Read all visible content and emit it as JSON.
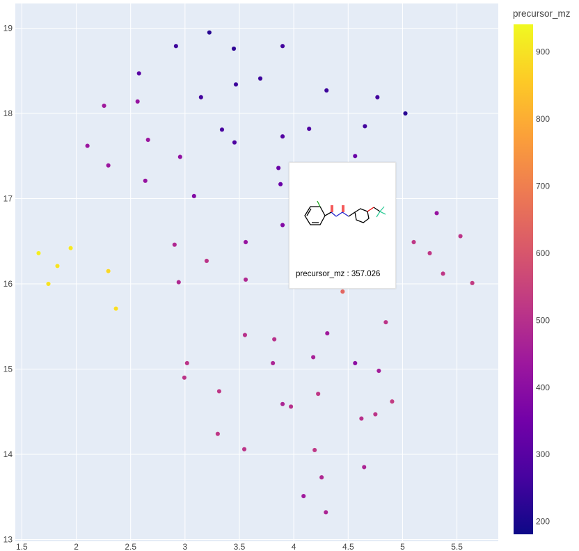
{
  "chart_data": {
    "type": "scatter",
    "title": "",
    "xlabel": "",
    "ylabel": "",
    "xlim": [
      1.44,
      5.88
    ],
    "ylim": [
      12.98,
      19.29
    ],
    "grid": true,
    "x_ticks": [
      1.5,
      2,
      2.5,
      3,
      3.5,
      4,
      4.5,
      5,
      5.5
    ],
    "x_tick_labels": [
      "1.5",
      "2",
      "2.5",
      "3",
      "3.5",
      "4",
      "4.5",
      "5",
      "5.5"
    ],
    "y_ticks": [
      13,
      14,
      15,
      16,
      17,
      18,
      19
    ],
    "y_tick_labels": [
      "13",
      "14",
      "15",
      "16",
      "17",
      "18",
      "19"
    ],
    "colorbar": {
      "title": "precursor_mz",
      "colorscale": "Plasma",
      "colors": [
        "#0d0887",
        "#46039f",
        "#7201a8",
        "#9c179e",
        "#bd3786",
        "#d8576b",
        "#ed7953",
        "#fb9f3a",
        "#fdca26",
        "#f0f921"
      ],
      "cmin": 181,
      "cmax": 941,
      "ticks": [
        200,
        300,
        400,
        500,
        600,
        700,
        800,
        900
      ],
      "tick_labels": [
        "200",
        "300",
        "400",
        "500",
        "600",
        "700",
        "800",
        "900"
      ]
    },
    "points": [
      [
        3.224,
        18.95,
        220
      ],
      [
        2.917,
        18.79,
        250
      ],
      [
        3.449,
        18.76,
        230
      ],
      [
        3.897,
        18.79,
        260
      ],
      [
        2.577,
        18.47,
        300
      ],
      [
        3.692,
        18.41,
        250
      ],
      [
        3.468,
        18.34,
        250
      ],
      [
        3.147,
        18.19,
        260
      ],
      [
        4.301,
        18.27,
        250
      ],
      [
        4.769,
        18.19,
        260
      ],
      [
        2.256,
        18.09,
        440
      ],
      [
        2.564,
        18.14,
        420
      ],
      [
        5.026,
        18.0,
        220
      ],
      [
        3.34,
        17.81,
        270
      ],
      [
        4.141,
        17.82,
        280
      ],
      [
        4.654,
        17.85,
        260
      ],
      [
        3.897,
        17.73,
        290
      ],
      [
        3.455,
        17.66,
        280
      ],
      [
        2.103,
        17.62,
        430
      ],
      [
        2.66,
        17.69,
        430
      ],
      [
        2.955,
        17.49,
        410
      ],
      [
        4.564,
        17.5,
        330
      ],
      [
        2.295,
        17.39,
        430
      ],
      [
        3.859,
        17.36,
        330
      ],
      [
        2.635,
        17.21,
        420
      ],
      [
        3.878,
        17.17,
        330
      ],
      [
        3.083,
        17.03,
        380
      ],
      [
        5.314,
        16.83,
        420
      ],
      [
        3.897,
        16.69,
        380
      ],
      [
        5.103,
        16.49,
        520
      ],
      [
        3.558,
        16.49,
        420
      ],
      [
        2.904,
        16.46,
        480
      ],
      [
        5.532,
        16.56,
        510
      ],
      [
        5.25,
        16.36,
        520
      ],
      [
        1.654,
        16.36,
        920
      ],
      [
        1.949,
        16.42,
        910
      ],
      [
        1.827,
        16.21,
        900
      ],
      [
        3.199,
        16.27,
        510
      ],
      [
        2.295,
        16.15,
        880
      ],
      [
        5.372,
        16.12,
        520
      ],
      [
        1.744,
        16.0,
        900
      ],
      [
        2.942,
        16.02,
        480
      ],
      [
        3.558,
        16.05,
        480
      ],
      [
        4.186,
        16.0,
        540
      ],
      [
        5.641,
        16.01,
        530
      ],
      [
        2.365,
        15.71,
        890
      ],
      [
        4.449,
        15.91,
        640
      ],
      [
        4.846,
        15.55,
        510
      ],
      [
        4.308,
        15.42,
        440
      ],
      [
        3.551,
        15.4,
        500
      ],
      [
        3.821,
        15.35,
        500
      ],
      [
        3.019,
        15.07,
        510
      ],
      [
        3.808,
        15.07,
        470
      ],
      [
        4.179,
        15.14,
        460
      ],
      [
        4.564,
        15.07,
        400
      ],
      [
        4.782,
        14.98,
        450
      ],
      [
        2.994,
        14.9,
        510
      ],
      [
        3.314,
        14.74,
        520
      ],
      [
        4.224,
        14.71,
        520
      ],
      [
        4.904,
        14.62,
        530
      ],
      [
        3.897,
        14.59,
        470
      ],
      [
        3.974,
        14.56,
        500
      ],
      [
        4.75,
        14.47,
        510
      ],
      [
        4.622,
        14.42,
        500
      ],
      [
        3.301,
        14.24,
        520
      ],
      [
        3.545,
        14.06,
        510
      ],
      [
        4.192,
        14.05,
        520
      ],
      [
        4.647,
        13.85,
        470
      ],
      [
        4.256,
        13.73,
        480
      ],
      [
        4.09,
        13.51,
        440
      ],
      [
        4.295,
        13.32,
        470
      ]
    ],
    "point_fields": [
      "x",
      "y",
      "precursor_mz"
    ]
  },
  "tooltip": {
    "field": "precursor_mz",
    "separator": " : ",
    "value": "357.026",
    "text": "precursor_mz : 357.026"
  }
}
